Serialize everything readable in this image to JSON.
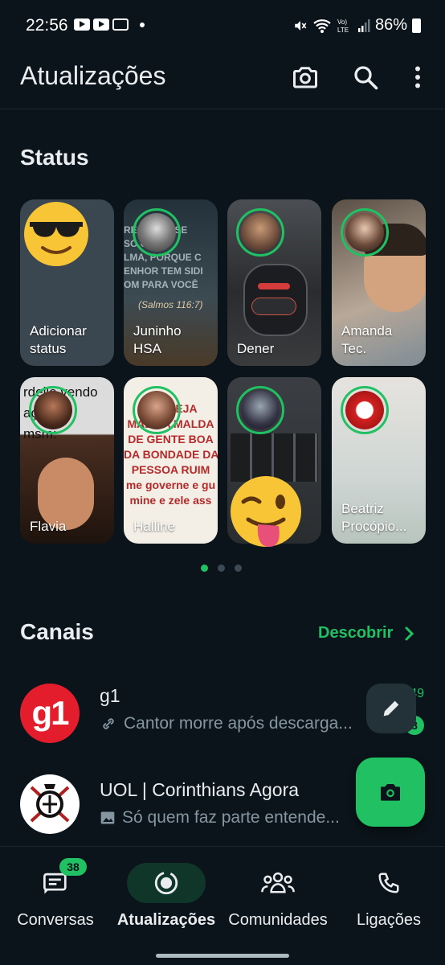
{
  "status_bar": {
    "time": "22:56",
    "battery": "86%"
  },
  "header": {
    "title": "Atualizações"
  },
  "status": {
    "title": "Status",
    "cards": [
      {
        "name": "Adicionar\nstatus"
      },
      {
        "name": "Juninho\nHSA"
      },
      {
        "name": "Dener"
      },
      {
        "name": "Amanda\nTec."
      },
      {
        "name": "Flavia"
      },
      {
        "name": "Halline"
      },
      {
        "name": ""
      },
      {
        "name": "Beatriz\nProcópio..."
      }
    ],
    "texts": {
      "juninho_bg": "RECEBAO SE\nSÓ O MIN\nLMA, PORQUE C\nENHOR TEM SIDI\nOM PARA VOCÊ",
      "juninho_ref": "(Salmos 116:7)",
      "flavia_bg": "rdeile vendo\nação po\nmsm:",
      "halline_bg": "PROTEJA\nMAL DA MALDA\nDE GENTE BOA\nDA BONDADE DA\nPESSOA RUIM\nme governe e gu\nmine e zele ass"
    },
    "pager": {
      "count": 3,
      "active": 0
    }
  },
  "channels": {
    "title": "Canais",
    "discover_label": "Descobrir",
    "items": [
      {
        "name": "g1",
        "avatar_text": "g1",
        "preview": "Cantor morre após descarga...",
        "time": "49",
        "badge": "8"
      },
      {
        "name": "UOL | Corinthians Agora",
        "preview": "Só quem faz parte entende...",
        "badge": ""
      }
    ]
  },
  "nav": {
    "items": [
      {
        "label": "Conversas",
        "badge": "38"
      },
      {
        "label": "Atualizações"
      },
      {
        "label": "Comunidades"
      },
      {
        "label": "Ligações"
      }
    ]
  },
  "colors": {
    "accent": "#21c063",
    "background": "#0b141a",
    "secondary_text": "#8696a0"
  }
}
